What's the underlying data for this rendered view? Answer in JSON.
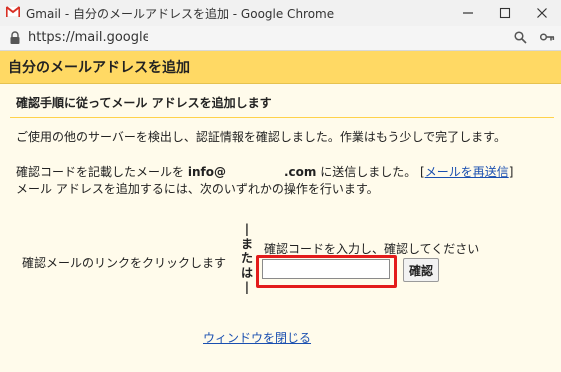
{
  "window": {
    "title": "Gmail - 自分のメールアドレスを追加 - Google Chrome",
    "minimize": "–",
    "maximize": "☐",
    "close": "✕"
  },
  "address_bar": {
    "url": "https://mail.google.c"
  },
  "page": {
    "title": "自分のメールアドレスを追加",
    "subheading": "確認手順に従ってメール アドレスを追加します",
    "intro": "ご使用の他のサーバーを検出し、認証情報を確認しました。作業はもう少しで完了します。",
    "sent_prefix": "確認コードを記載したメールを ",
    "email_start": "info@",
    "email_end": ".com",
    "sent_suffix": " に送信しました。 [",
    "resend_link": "メールを再送信",
    "resend_close": "]",
    "instruction": "メール アドレスを追加するには、次のいずれかの操作を行います。",
    "click_option": "確認メールのリンクをクリックします",
    "or_chars": [
      "|",
      "ま",
      "た",
      "は",
      "|"
    ],
    "enter_code_label": "確認コードを入力し、確認してください",
    "code_value": "",
    "confirm_button": "確認",
    "close_link": "ウィンドウを閉じる"
  },
  "colors": {
    "header_bg": "#ffd964",
    "content_bg": "#fffbeb",
    "link": "#1a4fb0",
    "highlight": "#e31b1b"
  },
  "icons": [
    "gmail-icon",
    "minimize-icon",
    "maximize-icon",
    "close-icon",
    "lock-icon",
    "search-icon",
    "key-icon"
  ]
}
